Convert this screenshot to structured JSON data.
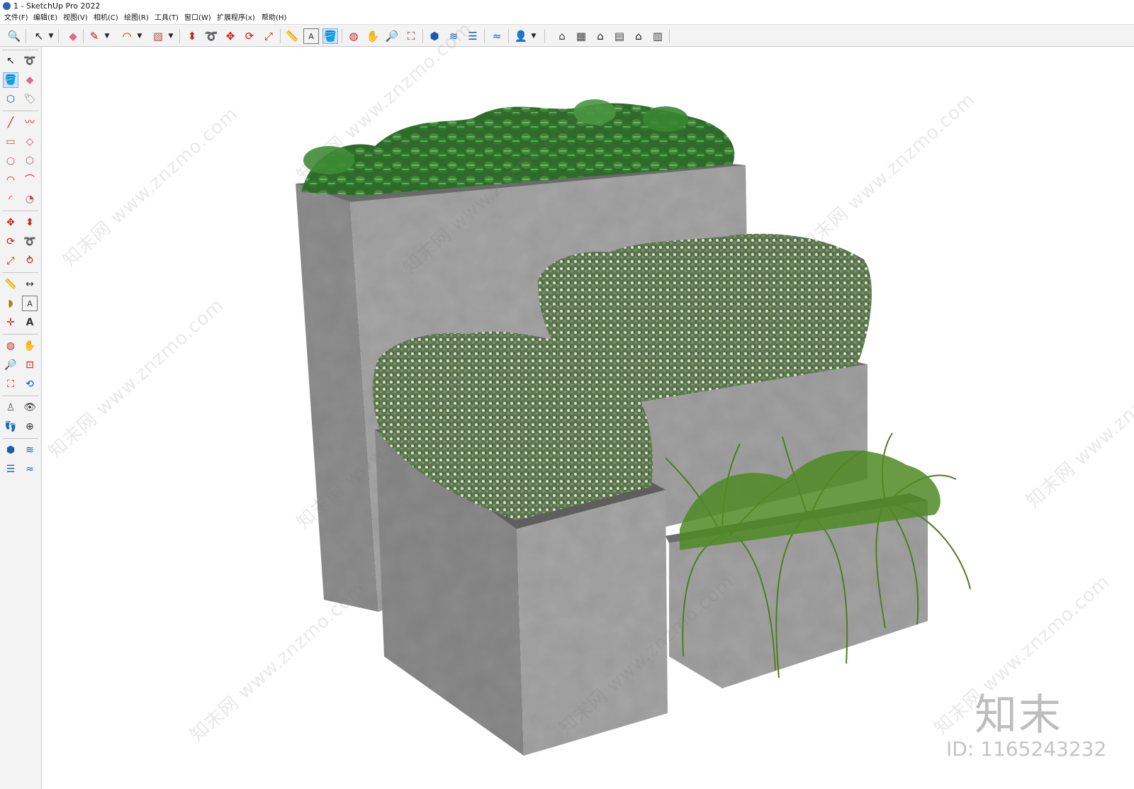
{
  "window": {
    "title": "1 - SketchUp Pro 2022"
  },
  "menubar": {
    "items": [
      "文件(F)",
      "编辑(E)",
      "视图(V)",
      "相机(C)",
      "绘图(R)",
      "工具(T)",
      "窗口(W)",
      "扩展程序(x)",
      "帮助(H)"
    ]
  },
  "toolbar": {
    "tools": [
      {
        "name": "search-icon",
        "glyph": "🔍"
      },
      {
        "name": "select-icon",
        "glyph": "↖"
      },
      {
        "name": "eraser-icon",
        "glyph": "◆"
      },
      {
        "name": "pencil-icon",
        "glyph": "✎"
      },
      {
        "name": "arc-icon",
        "glyph": "◠"
      },
      {
        "name": "rectangle-icon",
        "glyph": "▧"
      },
      {
        "name": "push-pull-icon",
        "glyph": "⬍"
      },
      {
        "name": "follow-me-icon",
        "glyph": "➰"
      },
      {
        "name": "move-icon",
        "glyph": "✥"
      },
      {
        "name": "rotate-icon",
        "glyph": "⟳"
      },
      {
        "name": "scale-icon",
        "glyph": "⤢"
      },
      {
        "name": "tape-measure-icon",
        "glyph": "📏"
      },
      {
        "name": "text-icon",
        "glyph": "A"
      },
      {
        "name": "paint-bucket-icon",
        "glyph": "🪣"
      },
      {
        "name": "orbit-icon",
        "glyph": "◍"
      },
      {
        "name": "pan-icon",
        "glyph": "✋"
      },
      {
        "name": "zoom-icon",
        "glyph": "🔎"
      },
      {
        "name": "zoom-extents-icon",
        "glyph": "⛶"
      },
      {
        "name": "warehouse-icon",
        "glyph": "⬢"
      },
      {
        "name": "extension-icon",
        "glyph": "≋"
      },
      {
        "name": "layers-icon",
        "glyph": "☰"
      },
      {
        "name": "sandbox-icon",
        "glyph": "≈"
      },
      {
        "name": "account-icon",
        "glyph": "👤"
      },
      {
        "name": "iso-view-icon",
        "glyph": "⌂"
      },
      {
        "name": "top-view-icon",
        "glyph": "▦"
      },
      {
        "name": "front-view-icon",
        "glyph": "⌂"
      },
      {
        "name": "right-view-icon",
        "glyph": "▤"
      },
      {
        "name": "back-view-icon",
        "glyph": "⌂"
      },
      {
        "name": "left-view-icon",
        "glyph": "▥"
      }
    ]
  },
  "lefttray": {
    "tools": [
      {
        "name": "select-icon",
        "glyph": "↖"
      },
      {
        "name": "lasso-icon",
        "glyph": "➰"
      },
      {
        "name": "paint-bucket-icon",
        "glyph": "🪣"
      },
      {
        "name": "eraser-icon",
        "glyph": "◆"
      },
      {
        "name": "component-icon",
        "glyph": "⬡"
      },
      {
        "name": "tag-icon",
        "glyph": "🏷"
      },
      {
        "name": "line-icon",
        "glyph": "╱"
      },
      {
        "name": "freehand-icon",
        "glyph": "〰"
      },
      {
        "name": "rectangle-icon",
        "glyph": "▭"
      },
      {
        "name": "rotated-rectangle-icon",
        "glyph": "◇"
      },
      {
        "name": "circle-icon",
        "glyph": "○"
      },
      {
        "name": "polygon-icon",
        "glyph": "⬡"
      },
      {
        "name": "arc-icon",
        "glyph": "◠"
      },
      {
        "name": "two-point-arc-icon",
        "glyph": "⌒"
      },
      {
        "name": "three-point-arc-icon",
        "glyph": "◜"
      },
      {
        "name": "pie-icon",
        "glyph": "◔"
      },
      {
        "name": "move-icon",
        "glyph": "✥"
      },
      {
        "name": "push-pull-icon",
        "glyph": "⬍"
      },
      {
        "name": "rotate-icon",
        "glyph": "⟳"
      },
      {
        "name": "follow-me-icon",
        "glyph": "➰"
      },
      {
        "name": "scale-icon",
        "glyph": "⤢"
      },
      {
        "name": "offset-icon",
        "glyph": "⥁"
      },
      {
        "name": "tape-measure-icon",
        "glyph": "📏"
      },
      {
        "name": "dimension-icon",
        "glyph": "↔"
      },
      {
        "name": "protractor-icon",
        "glyph": "◗"
      },
      {
        "name": "text-icon",
        "glyph": "A"
      },
      {
        "name": "axes-icon",
        "glyph": "✛"
      },
      {
        "name": "3d-text-icon",
        "glyph": "A"
      },
      {
        "name": "orbit-icon",
        "glyph": "◍"
      },
      {
        "name": "pan-icon",
        "glyph": "✋"
      },
      {
        "name": "zoom-icon",
        "glyph": "🔎"
      },
      {
        "name": "zoom-window-icon",
        "glyph": "⊡"
      },
      {
        "name": "zoom-extents-icon",
        "glyph": "⛶"
      },
      {
        "name": "previous-view-icon",
        "glyph": "⟲"
      },
      {
        "name": "position-camera-icon",
        "glyph": "♙"
      },
      {
        "name": "look-around-icon",
        "glyph": "👁"
      },
      {
        "name": "walk-icon",
        "glyph": "👣"
      },
      {
        "name": "section-plane-icon",
        "glyph": "⊕"
      },
      {
        "name": "warehouse-icon",
        "glyph": "⬢"
      },
      {
        "name": "extension-icon",
        "glyph": "≋"
      },
      {
        "name": "layers-icon",
        "glyph": "☰"
      },
      {
        "name": "sandbox-icon",
        "glyph": "≈"
      }
    ]
  },
  "watermark": {
    "diagonal_text": "知末网 www.znzmo.com",
    "brand": "知末",
    "id_text": "ID: 1165243232"
  },
  "colors": {
    "toolbar_bg": "#f3f3f3",
    "active_tool": "#cfe3fa",
    "concrete": "#9c9c9c",
    "foliage_dark": "#2f6a2a",
    "foliage_light": "#8aa07a",
    "grass": "#4e7e1e"
  }
}
